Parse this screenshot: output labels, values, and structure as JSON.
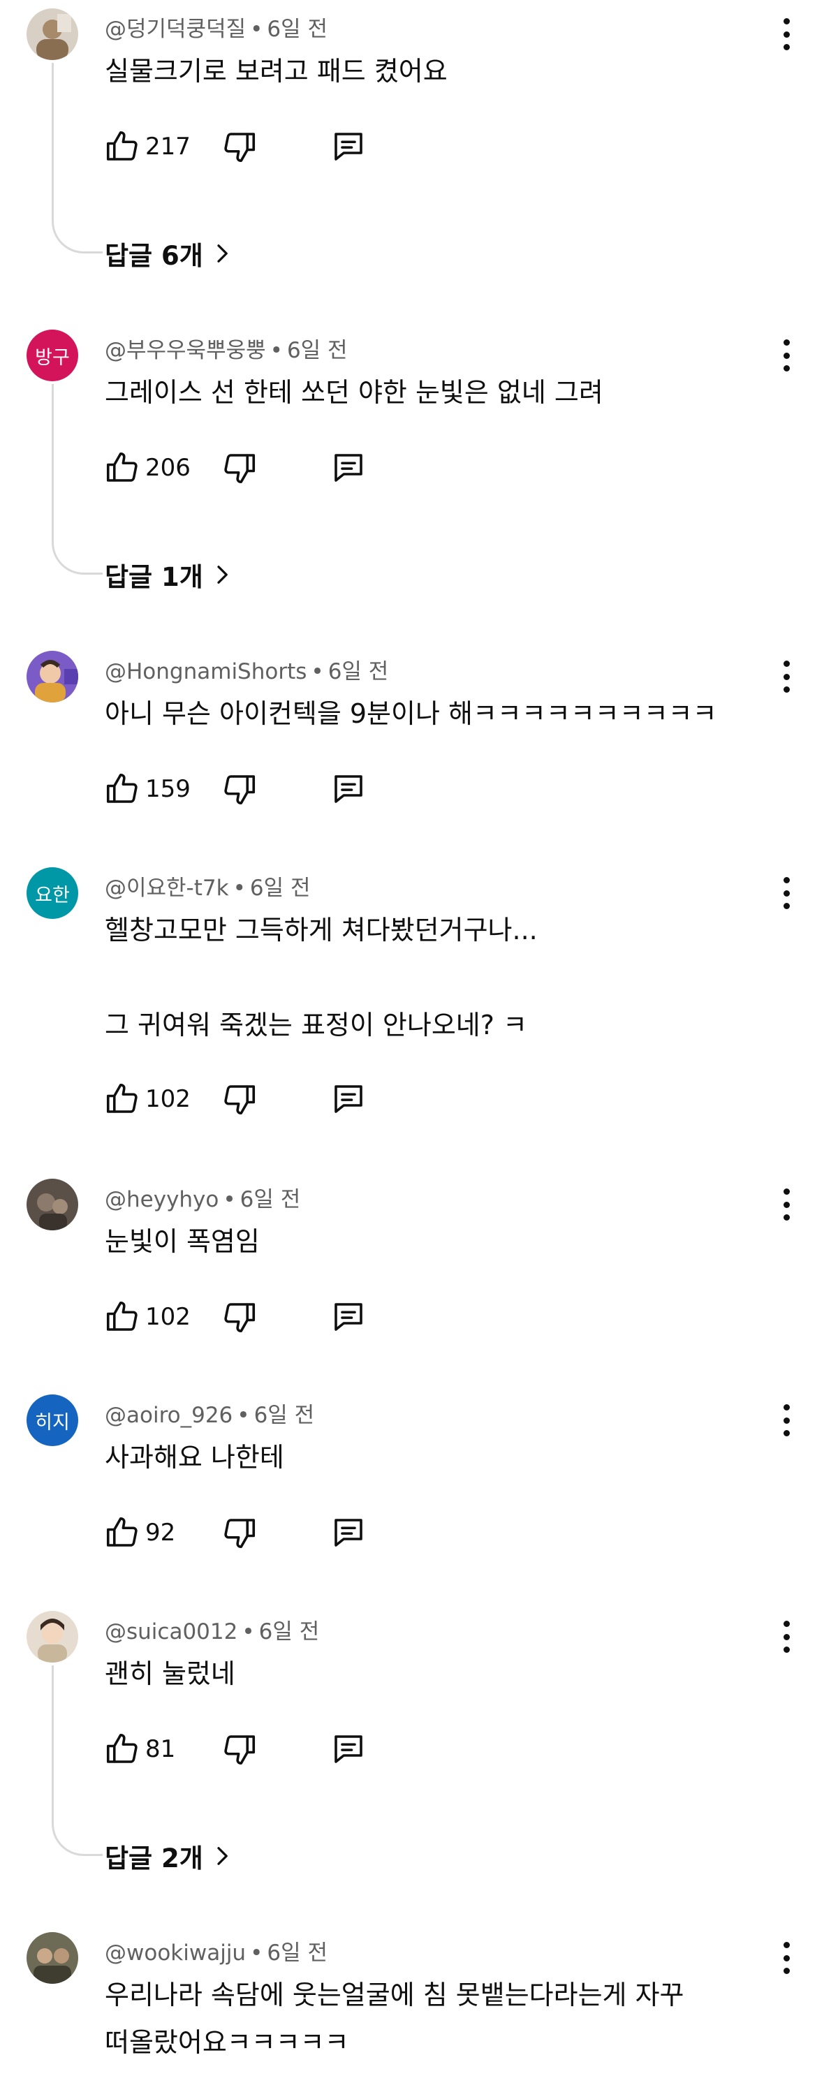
{
  "comments": [
    {
      "author": "@덩기덕쿵덕질",
      "time": "6일 전",
      "text": "실물크기로 보려고 패드 켰어요",
      "likes": "217",
      "replies": "답글 6개",
      "avatar": {
        "type": "photo",
        "initials": "",
        "color": "#b9a58a"
      }
    },
    {
      "author": "@부우우욱뿌웅뿡",
      "time": "6일 전",
      "text": "그레이스 선 한테 쏘던 야한 눈빛은 없네 그려",
      "likes": "206",
      "replies": "답글 1개",
      "avatar": {
        "type": "initials",
        "initials": "방구",
        "color": "#d4145a"
      }
    },
    {
      "author": "@HongnamiShorts",
      "time": "6일 전",
      "text": "아니 무슨 아이컨텍을 9분이나 해ㅋㅋㅋㅋㅋㅋㅋㅋㅋㅋ",
      "likes": "159",
      "replies": "",
      "avatar": {
        "type": "photo",
        "initials": "",
        "color": "#7b5cc7"
      }
    },
    {
      "author": "@이요한-t7k",
      "time": "6일 전",
      "text": "헬창고모만 그득하게 쳐다봤던거구나...\n\n그 귀여워 죽겠는 표정이 안나오네? ㅋ",
      "likes": "102",
      "replies": "",
      "avatar": {
        "type": "initials",
        "initials": "요한",
        "color": "#0097a7"
      }
    },
    {
      "author": "@heyyhyo",
      "time": "6일 전",
      "text": "눈빛이 폭염임",
      "likes": "102",
      "replies": "",
      "avatar": {
        "type": "photo",
        "initials": "",
        "color": "#5a5048"
      }
    },
    {
      "author": "@aoiro_926",
      "time": "6일 전",
      "text": "사과해요 나한테",
      "likes": "92",
      "replies": "",
      "avatar": {
        "type": "initials",
        "initials": "히지",
        "color": "#1565c0"
      }
    },
    {
      "author": "@suica0012",
      "time": "6일 전",
      "text": "괜히 눌렀네",
      "likes": "81",
      "replies": "답글 2개",
      "avatar": {
        "type": "photo",
        "initials": "",
        "color": "#c9b79c"
      }
    },
    {
      "author": "@wookiwajju",
      "time": "6일 전",
      "text": "우리나라 속담에 웃는얼굴에 침 못뱉는다라는게 자꾸\n떠올랐어요ㅋㅋㅋㅋㅋ",
      "likes": "",
      "replies": "",
      "avatar": {
        "type": "photo",
        "initials": "",
        "color": "#6d6a55"
      }
    }
  ]
}
